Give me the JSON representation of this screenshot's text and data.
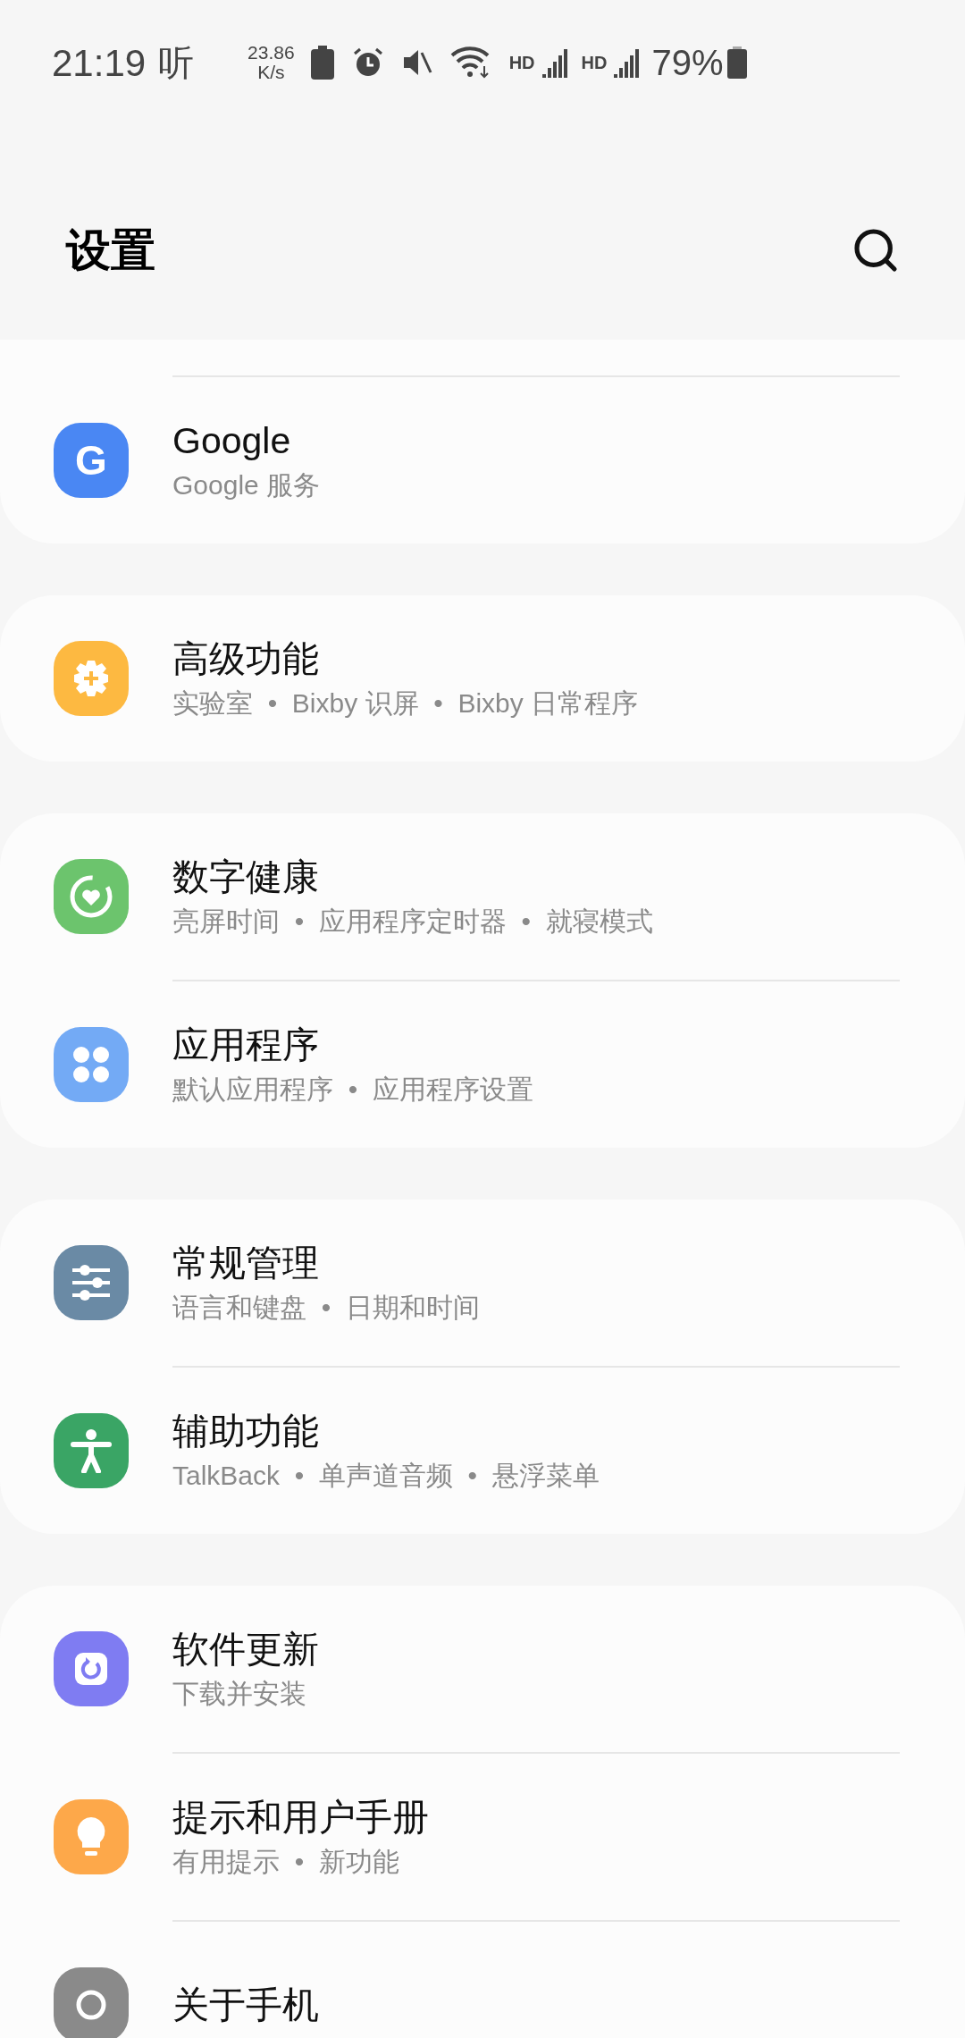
{
  "status_bar": {
    "time": "21:19",
    "notification": "听",
    "net_speed": "23.86",
    "net_unit": "K/s",
    "network_1": "HD",
    "network_2": "HD",
    "battery": "79%"
  },
  "header": {
    "title": "设置"
  },
  "groups": [
    {
      "items": [
        {
          "kind": "google",
          "color": "#4a87f3",
          "title": "Google",
          "subtitle": "Google 服务",
          "glyph": "G"
        }
      ],
      "cut_top": true
    },
    {
      "items": [
        {
          "kind": "advanced",
          "color": "#fdb941",
          "title": "高级功能",
          "subtitle": "实验室  •  Bixby 识屏  •  Bixby 日常程序"
        }
      ]
    },
    {
      "items": [
        {
          "kind": "wellbeing",
          "color": "#6cc46d",
          "title": "数字健康",
          "subtitle": "亮屏时间  •  应用程序定时器  •  就寝模式"
        },
        {
          "kind": "apps",
          "color": "#73aaf5",
          "title": "应用程序",
          "subtitle": "默认应用程序  •  应用程序设置"
        }
      ]
    },
    {
      "items": [
        {
          "kind": "general",
          "color": "#6a8aa5",
          "title": "常规管理",
          "subtitle": "语言和键盘  •  日期和时间"
        },
        {
          "kind": "accessibility",
          "color": "#3aa565",
          "title": "辅助功能",
          "subtitle": "TalkBack  •  单声道音频  •  悬浮菜单"
        }
      ]
    },
    {
      "items": [
        {
          "kind": "update",
          "color": "#7f7cf2",
          "title": "软件更新",
          "subtitle": "下载并安装"
        },
        {
          "kind": "tips",
          "color": "#fda84a",
          "title": "提示和用户手册",
          "subtitle": "有用提示  •  新功能"
        },
        {
          "kind": "about",
          "color": "#8a8a8a",
          "title": "关于手机"
        }
      ]
    }
  ]
}
